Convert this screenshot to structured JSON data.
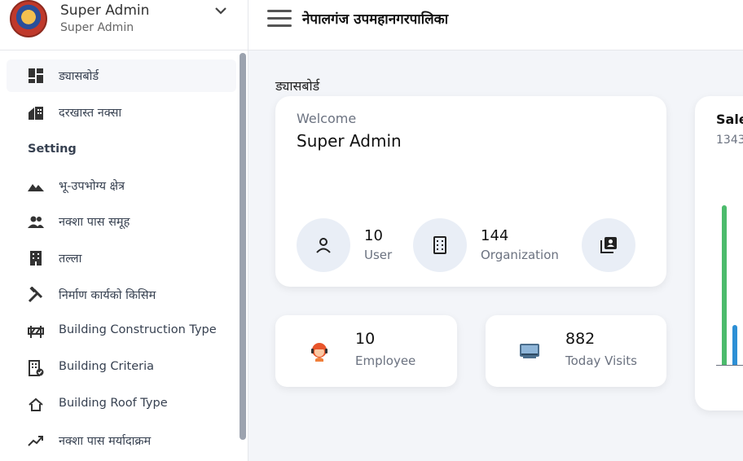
{
  "profile": {
    "name": "Super Admin",
    "role": "Super Admin"
  },
  "header": {
    "title": "नेपालगंज उपमहानगरपालिका"
  },
  "page": {
    "title": "ड्यासबोर्ड"
  },
  "sidebar": {
    "items": [
      {
        "label": "ड्यासबोर्ड",
        "icon": "dashboard-icon"
      },
      {
        "label": "दरखास्त नक्सा",
        "icon": "house-icon"
      }
    ],
    "section": "Setting",
    "settings": [
      {
        "label": "भू-उपभोग्य क्षेत्र",
        "icon": "landscape-icon"
      },
      {
        "label": "नक्शा पास समूह",
        "icon": "group-icon"
      },
      {
        "label": "तल्ला",
        "icon": "building-icon"
      },
      {
        "label": "निर्माण कार्यको किसिम",
        "icon": "tools-icon"
      },
      {
        "label": "Building Construction Type",
        "icon": "construction-icon"
      },
      {
        "label": "Building Criteria",
        "icon": "criteria-icon"
      },
      {
        "label": "Building Roof Type",
        "icon": "roof-icon"
      },
      {
        "label": "नक्शा पास मर्यादाक्रम",
        "icon": "trending-icon"
      }
    ]
  },
  "welcome": {
    "label": "Welcome",
    "name": "Super Admin",
    "stats": [
      {
        "value": "10",
        "label": "User",
        "icon": "user-icon"
      },
      {
        "value": "144",
        "label": "Organization",
        "icon": "organization-icon"
      },
      {
        "value": "",
        "label": "",
        "icon": "contact-icon"
      }
    ]
  },
  "cards": [
    {
      "value": "10",
      "label": "Employee",
      "icon": "employee-icon"
    },
    {
      "value": "882",
      "label": "Today Visits",
      "icon": "computer-icon"
    }
  ],
  "sales": {
    "title": "Sale",
    "subtitle": "1343"
  },
  "colors": {
    "accent_green": "#4cbb6c",
    "accent_blue": "#2d8fd5"
  }
}
